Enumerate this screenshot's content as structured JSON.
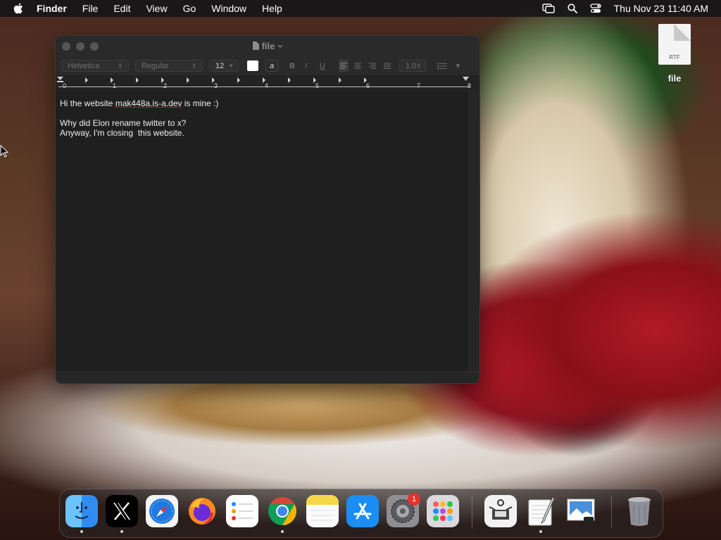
{
  "menubar": {
    "app": "Finder",
    "items": [
      "File",
      "Edit",
      "View",
      "Go",
      "Window",
      "Help"
    ],
    "clock": "Thu Nov 23  11:40 AM"
  },
  "desktop": {
    "file_name": "file",
    "file_ext": "RTF"
  },
  "window": {
    "title": "file",
    "toolbar": {
      "font_family": "Helvetica",
      "font_style": "Regular",
      "font_size": "12",
      "bold": "B",
      "italic": "I",
      "underline": "U",
      "line_spacing": "1.0"
    },
    "ruler_numbers": [
      "0",
      "1",
      "2",
      "3",
      "4",
      "5",
      "6",
      "7",
      "8"
    ],
    "document": {
      "line1_prefix": "Hi the website ",
      "line1_link": "mak448a.is-a.dev",
      "line1_suffix": " is mine :)",
      "line2": "",
      "line3": "Why did Elon rename twitter to x?",
      "line4": "Anyway, I'm closing  this website."
    }
  },
  "dock": {
    "apps": [
      "finder",
      "x",
      "safari",
      "firefox",
      "reminders",
      "chrome",
      "notes",
      "app-store",
      "system-settings",
      "launchpad",
      "screenshot-tool",
      "textedit",
      "preview",
      "trash"
    ],
    "settings_badge": "1",
    "colors": {
      "finder": "#2f8cf3",
      "safari": "#1f7ae0",
      "firefox": "#ff8a1e",
      "chrome_red": "#db4437",
      "chrome_yellow": "#f4b400",
      "chrome_green": "#0f9d58",
      "chrome_blue": "#4285f4",
      "notes": "#f7d74a",
      "appstore": "#1a8ef5"
    }
  }
}
